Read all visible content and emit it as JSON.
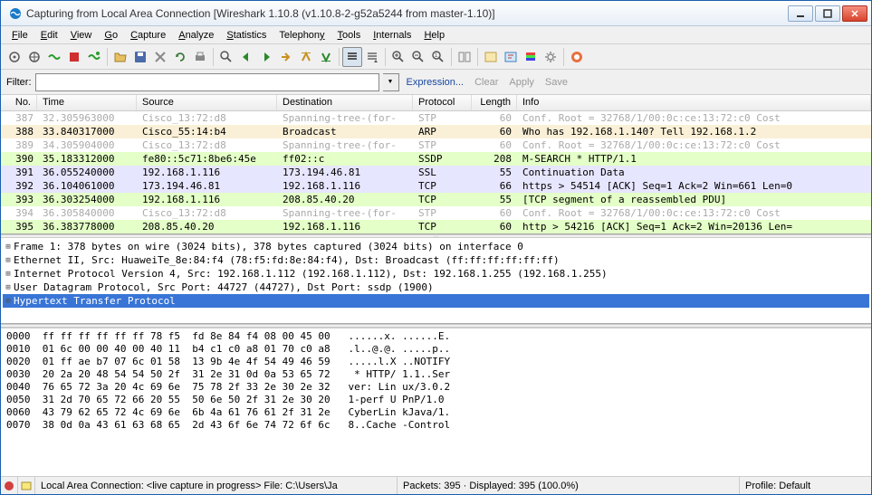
{
  "titlebar": {
    "text": "Capturing from Local Area Connection   [Wireshark 1.10.8   (v1.10.8-2-g52a5244 from master-1.10)]"
  },
  "menu": [
    "File",
    "Edit",
    "View",
    "Go",
    "Capture",
    "Analyze",
    "Statistics",
    "Telephony",
    "Tools",
    "Internals",
    "Help"
  ],
  "filter": {
    "label": "Filter:",
    "value": "",
    "expression": "Expression...",
    "clear": "Clear",
    "apply": "Apply",
    "save": "Save"
  },
  "columns": [
    "No.",
    "Time",
    "Source",
    "Destination",
    "Protocol",
    "Length",
    "Info"
  ],
  "packets": [
    {
      "no": "387",
      "time": "32.305963000",
      "src": "Cisco_13:72:d8",
      "dst": "Spanning-tree-(for-",
      "proto": "STP",
      "len": "60",
      "info": "Conf. Root = 32768/1/00:0c:ce:13:72:c0  Cost",
      "bg": "#ffffff",
      "fg": "#aaaaaa"
    },
    {
      "no": "388",
      "time": "33.840317000",
      "src": "Cisco_55:14:b4",
      "dst": "Broadcast",
      "proto": "ARP",
      "len": "60",
      "info": "Who has 192.168.1.140?  Tell 192.168.1.2",
      "bg": "#faf0d7",
      "fg": "#000000"
    },
    {
      "no": "389",
      "time": "34.305904000",
      "src": "Cisco_13:72:d8",
      "dst": "Spanning-tree-(for-",
      "proto": "STP",
      "len": "60",
      "info": "Conf. Root = 32768/1/00:0c:ce:13:72:c0  Cost",
      "bg": "#ffffff",
      "fg": "#aaaaaa"
    },
    {
      "no": "390",
      "time": "35.183312000",
      "src": "fe80::5c71:8be6:45e",
      "dst": "ff02::c",
      "proto": "SSDP",
      "len": "208",
      "info": "M-SEARCH * HTTP/1.1",
      "bg": "#e4ffc7",
      "fg": "#000000"
    },
    {
      "no": "391",
      "time": "36.055240000",
      "src": "192.168.1.116",
      "dst": "173.194.46.81",
      "proto": "SSL",
      "len": "55",
      "info": "Continuation Data",
      "bg": "#e7e6ff",
      "fg": "#000000"
    },
    {
      "no": "392",
      "time": "36.104061000",
      "src": "173.194.46.81",
      "dst": "192.168.1.116",
      "proto": "TCP",
      "len": "66",
      "info": "https > 54514 [ACK] Seq=1 Ack=2 Win=661 Len=0",
      "bg": "#e7e6ff",
      "fg": "#000000"
    },
    {
      "no": "393",
      "time": "36.303254000",
      "src": "192.168.1.116",
      "dst": "208.85.40.20",
      "proto": "TCP",
      "len": "55",
      "info": "[TCP segment of a reassembled PDU]",
      "bg": "#e4ffc7",
      "fg": "#000000"
    },
    {
      "no": "394",
      "time": "36.305840000",
      "src": "Cisco_13:72:d8",
      "dst": "Spanning-tree-(for-",
      "proto": "STP",
      "len": "60",
      "info": "Conf. Root = 32768/1/00:0c:ce:13:72:c0  Cost",
      "bg": "#ffffff",
      "fg": "#aaaaaa"
    },
    {
      "no": "395",
      "time": "36.383778000",
      "src": "208.85.40.20",
      "dst": "192.168.1.116",
      "proto": "TCP",
      "len": "60",
      "info": "http > 54216 [ACK] Seq=1 Ack=2 Win=20136 Len=",
      "bg": "#e4ffc7",
      "fg": "#000000"
    }
  ],
  "details": [
    {
      "text": "Frame 1: 378 bytes on wire (3024 bits), 378 bytes captured (3024 bits) on interface 0",
      "sel": false
    },
    {
      "text": "Ethernet II, Src: HuaweiTe_8e:84:f4 (78:f5:fd:8e:84:f4), Dst: Broadcast (ff:ff:ff:ff:ff:ff)",
      "sel": false
    },
    {
      "text": "Internet Protocol Version 4, Src: 192.168.1.112 (192.168.1.112), Dst: 192.168.1.255 (192.168.1.255)",
      "sel": false
    },
    {
      "text": "User Datagram Protocol, Src Port: 44727 (44727), Dst Port: ssdp (1900)",
      "sel": false
    },
    {
      "text": "Hypertext Transfer Protocol",
      "sel": true
    }
  ],
  "bytes": [
    "0000  ff ff ff ff ff ff 78 f5  fd 8e 84 f4 08 00 45 00   ......x. ......E.",
    "0010  01 6c 00 00 40 00 40 11  b4 c1 c0 a8 01 70 c0 a8   .l..@.@. .....p..",
    "0020  01 ff ae b7 07 6c 01 58  13 9b 4e 4f 54 49 46 59   .....l.X ..NOTIFY",
    "0030  20 2a 20 48 54 54 50 2f  31 2e 31 0d 0a 53 65 72    * HTTP/ 1.1..Ser",
    "0040  76 65 72 3a 20 4c 69 6e  75 78 2f 33 2e 30 2e 32   ver: Lin ux/3.0.2",
    "0050  31 2d 70 65 72 66 20 55  50 6e 50 2f 31 2e 30 20   1-perf U PnP/1.0 ",
    "0060  43 79 62 65 72 4c 69 6e  6b 4a 61 76 61 2f 31 2e   CyberLin kJava/1.",
    "0070  38 0d 0a 43 61 63 68 65  2d 43 6f 6e 74 72 6f 6c   8..Cache -Control"
  ],
  "status": {
    "left": "Local Area Connection: <live capture in progress> File: C:\\Users\\Ja",
    "middle": "Packets: 395 · Displayed: 395 (100.0%)",
    "profile": "Profile: Default"
  }
}
